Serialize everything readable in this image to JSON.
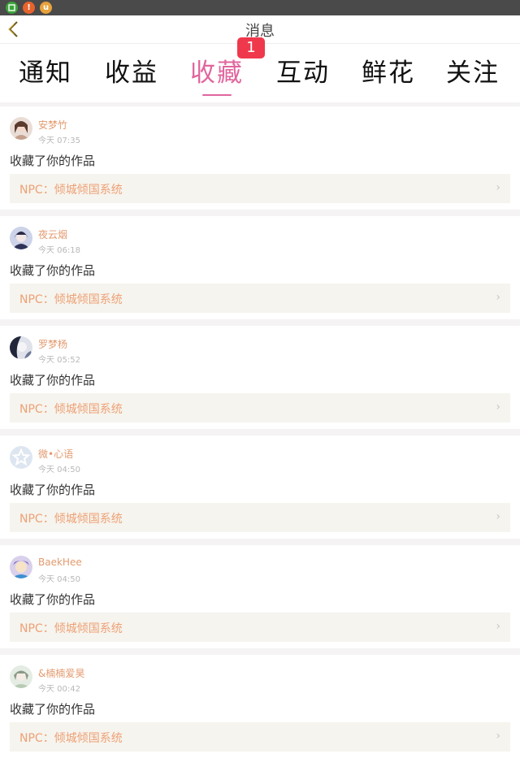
{
  "status_bar": {
    "icons": [
      "app-icon-green",
      "alert-icon",
      "uc-icon"
    ],
    "alert_glyph": "!",
    "uc_glyph": "u"
  },
  "header": {
    "title": "消息"
  },
  "tabs": [
    {
      "label": "通知"
    },
    {
      "label": "收益"
    },
    {
      "label": "收藏",
      "active": true,
      "badge": "1"
    },
    {
      "label": "互动"
    },
    {
      "label": "鲜花"
    },
    {
      "label": "关注"
    }
  ],
  "colors": {
    "accent": "#e0669e",
    "badge": "#f0384d",
    "username": "#e39a6f",
    "work_title": "#eda176"
  },
  "items": [
    {
      "user": "安梦竹",
      "time": "今天 07:35",
      "action": "收藏了你的作品",
      "work": "NPC：倾城倾国系统"
    },
    {
      "user": "夜云烟",
      "time": "今天 06:18",
      "action": "收藏了你的作品",
      "work": "NPC：倾城倾国系统"
    },
    {
      "user": "罗梦杨",
      "time": "今天 05:52",
      "action": "收藏了你的作品",
      "work": "NPC：倾城倾国系统"
    },
    {
      "user": "微•心语",
      "time": "今天 04:50",
      "action": "收藏了你的作品",
      "work": "NPC：倾城倾国系统"
    },
    {
      "user": "BaekHee",
      "time": "今天 04:50",
      "action": "收藏了你的作品",
      "work": "NPC：倾城倾国系统"
    },
    {
      "user": "&楠楠爱昊",
      "time": "今天 00:42",
      "action": "收藏了你的作品",
      "work": "NPC：倾城倾国系统"
    }
  ]
}
